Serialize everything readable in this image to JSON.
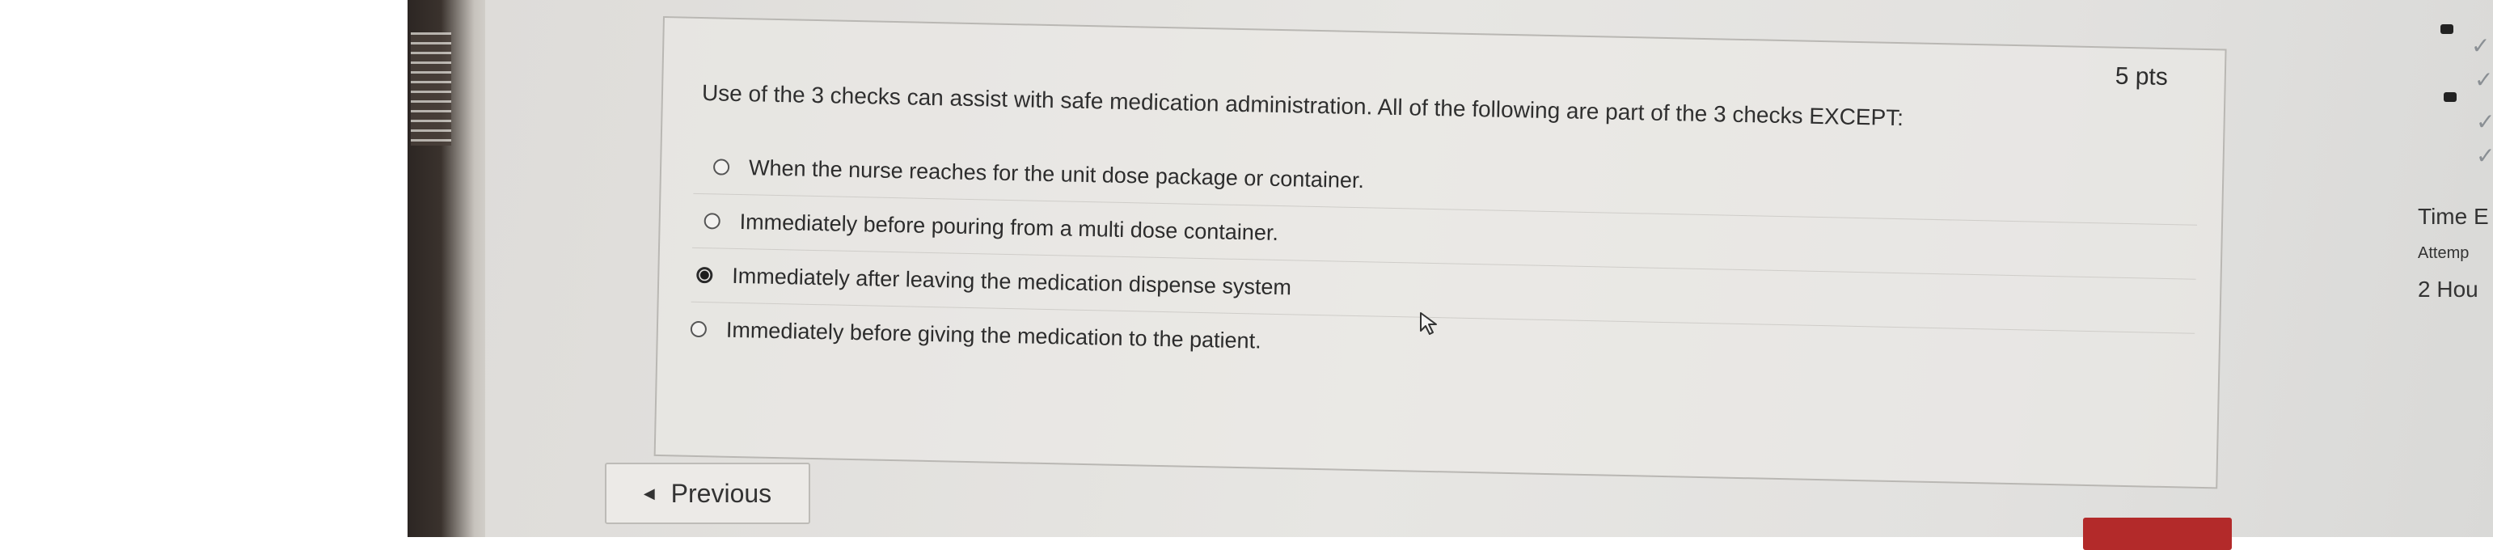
{
  "question": {
    "points": "5 pts",
    "text": "Use of the 3 checks can assist with safe medication administration. All of the following are part of the 3 checks EXCEPT:",
    "answers": [
      {
        "label": "When the nurse reaches for the unit dose package or container.",
        "selected": false
      },
      {
        "label": "Immediately before pouring from a multi dose container.",
        "selected": false
      },
      {
        "label": "Immediately after leaving the medication dispense system",
        "selected": true
      },
      {
        "label": "Immediately before giving the medication to the patient.",
        "selected": false
      }
    ]
  },
  "navigation": {
    "previous_label": "Previous",
    "next_label": ""
  },
  "sidebar": {
    "time_label": "Time E",
    "attempt_label": "Attemp",
    "hours_label": "2 Hou"
  },
  "icons": {
    "cursor": "mouse-pointer-icon",
    "previous": "triangle-left-icon",
    "question_flags": "checkmark-icon"
  },
  "colors": {
    "next_button": "#b32a2a",
    "screen_bg": "#e2e1df"
  }
}
